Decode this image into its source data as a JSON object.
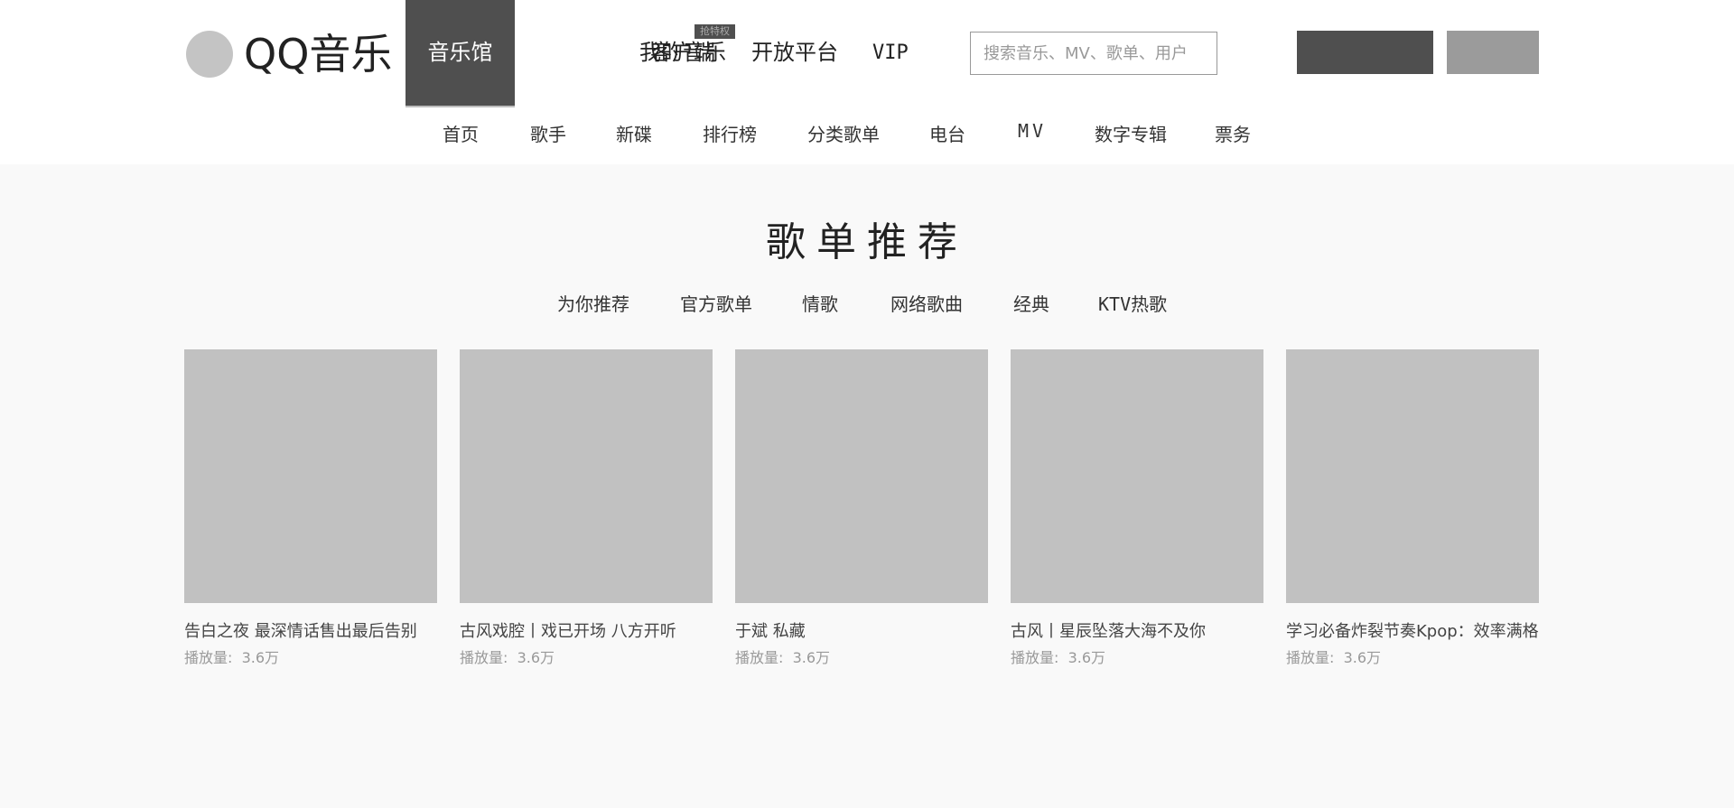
{
  "logo": {
    "text": "QQ音乐"
  },
  "main_nav": {
    "items": [
      "音乐馆",
      "我的音乐",
      "客户端",
      "开放平台",
      "VIP"
    ],
    "badge": "抢特权"
  },
  "search": {
    "placeholder": "搜索音乐、MV、歌单、用户"
  },
  "sub_nav": {
    "items": [
      "首页",
      "歌手",
      "新碟",
      "排行榜",
      "分类歌单",
      "电台",
      "MV",
      "数字专辑",
      "票务"
    ]
  },
  "section": {
    "title": "歌单推荐",
    "tags": [
      "为你推荐",
      "官方歌单",
      "情歌",
      "网络歌曲",
      "经典",
      "KTV热歌"
    ]
  },
  "playlists": [
    {
      "title": "告白之夜 最深情话售出最后告别",
      "plays_label": "播放量:",
      "plays": "3.6万"
    },
    {
      "title": "古风戏腔丨戏已开场 八方开听",
      "plays_label": "播放量:",
      "plays": "3.6万"
    },
    {
      "title": "于斌 私藏",
      "plays_label": "播放量:",
      "plays": "3.6万"
    },
    {
      "title": "古风丨星辰坠落大海不及你",
      "plays_label": "播放量:",
      "plays": "3.6万"
    },
    {
      "title": "学习必备炸裂节奏Kpop：效率满格",
      "plays_label": "播放量:",
      "plays": "3.6万"
    }
  ],
  "colors": {
    "active_nav": "#4f4f4f",
    "cover": "#c1c1c1",
    "page_bg": "#f9f9f9"
  }
}
